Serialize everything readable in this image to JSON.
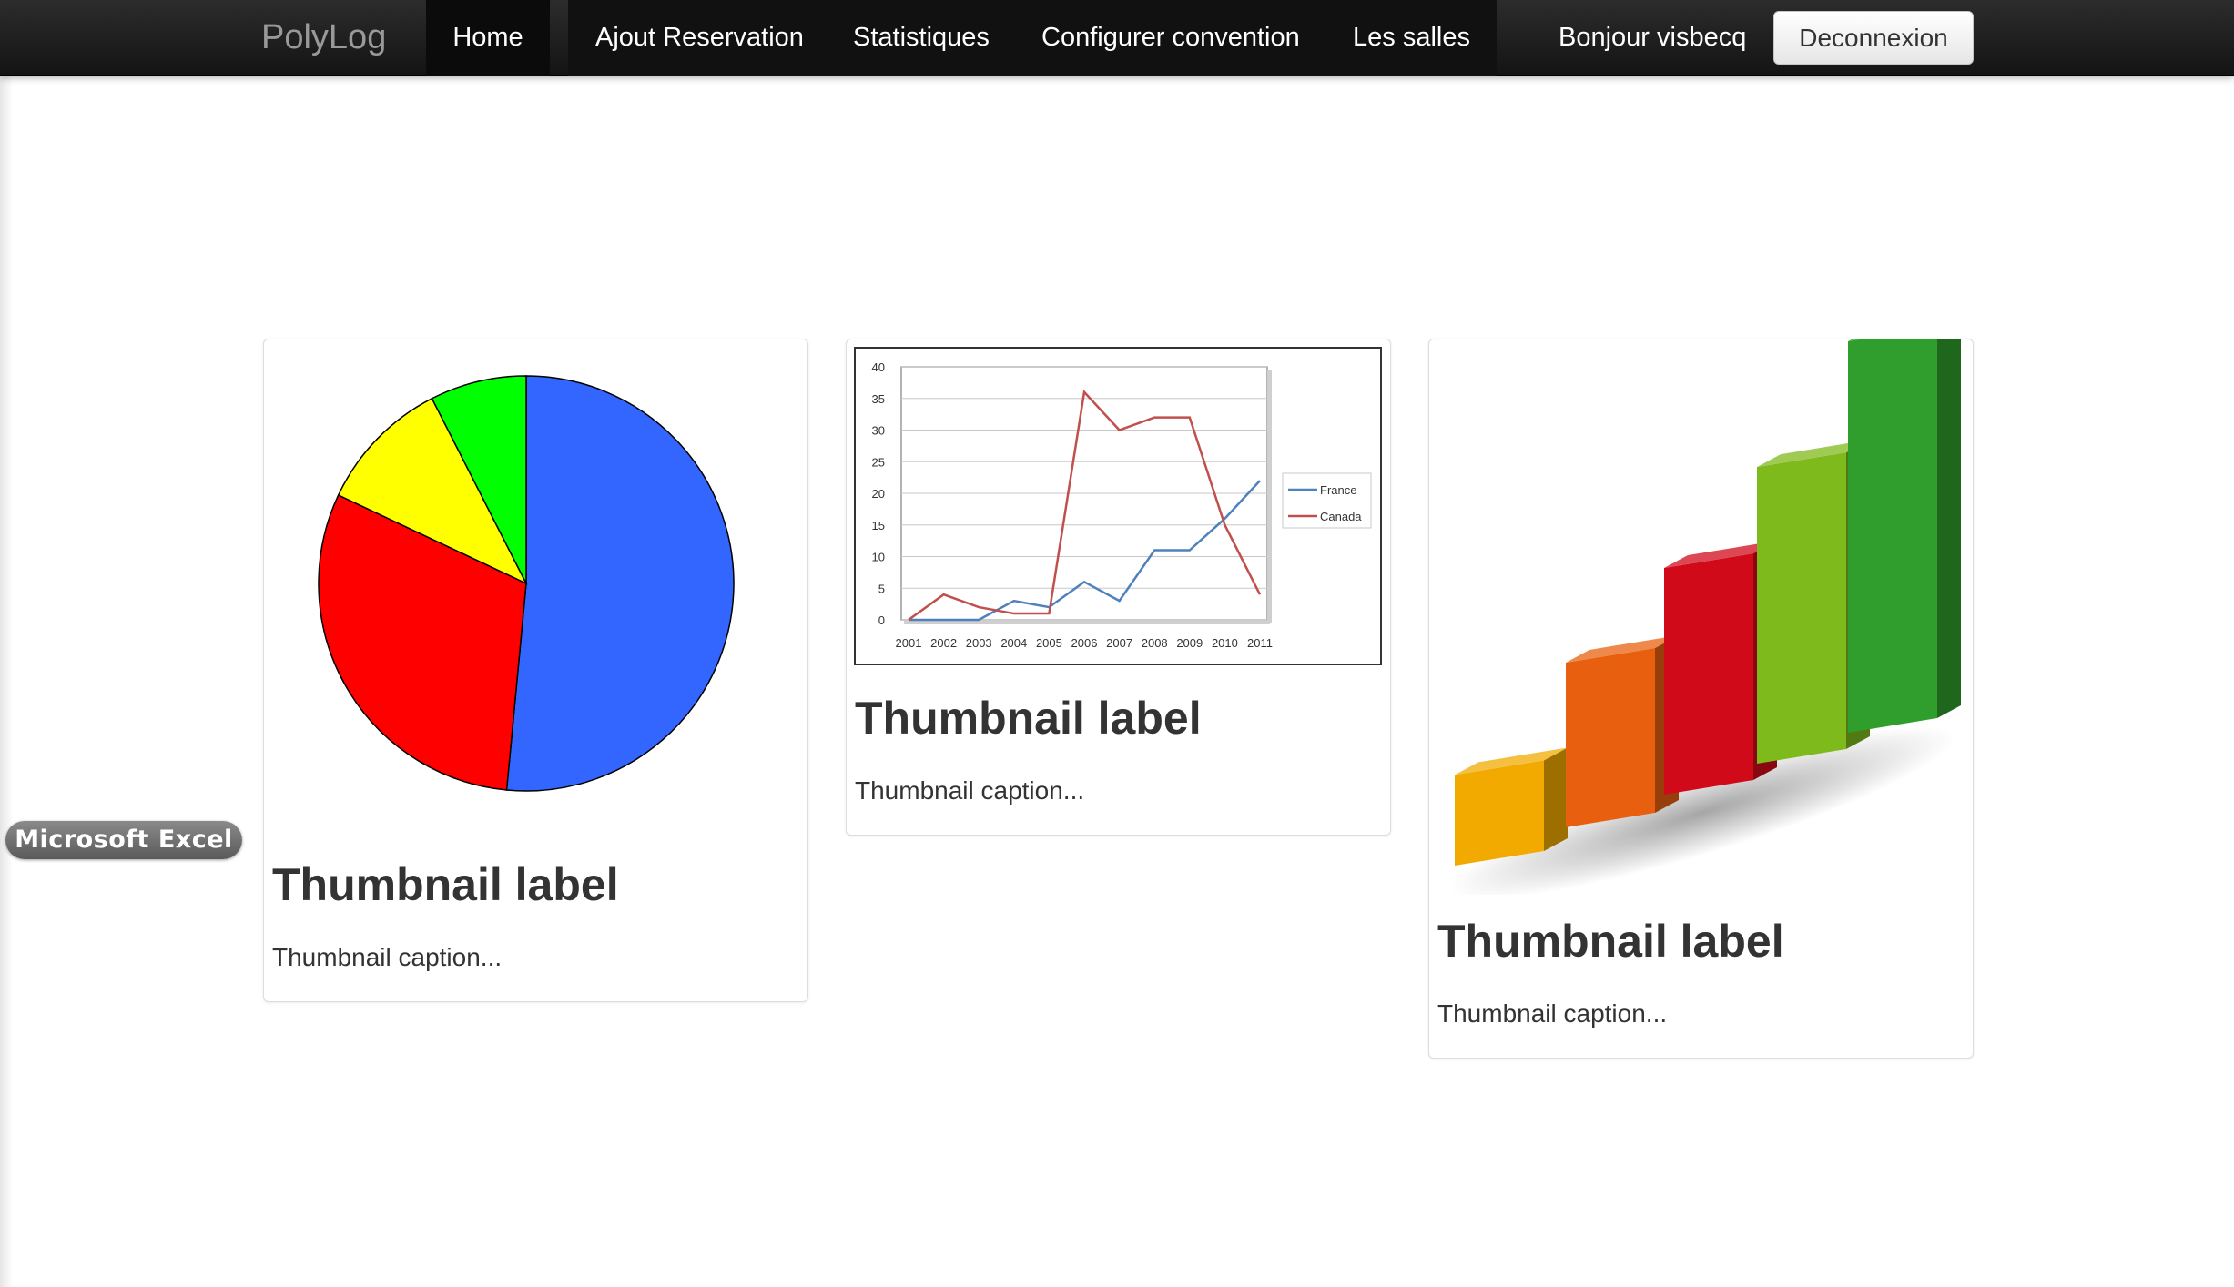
{
  "navbar": {
    "brand": "PolyLog",
    "items": [
      {
        "label": "Home"
      },
      {
        "label": "Ajout Reservation"
      },
      {
        "label": "Statistiques"
      },
      {
        "label": "Configurer convention"
      },
      {
        "label": "Les salles"
      }
    ],
    "greeting": "Bonjour visbecq",
    "logout_label": "Deconnexion"
  },
  "dock_tooltip": "Microsoft Excel",
  "thumbnails": [
    {
      "label": "Thumbnail label",
      "caption": "Thumbnail caption...",
      "image": "pie-chart"
    },
    {
      "label": "Thumbnail label",
      "caption": "Thumbnail caption...",
      "image": "line-chart"
    },
    {
      "label": "Thumbnail label",
      "caption": "Thumbnail caption...",
      "image": "3d-bar-chart"
    }
  ],
  "chart_data": [
    {
      "type": "pie",
      "slices": [
        {
          "value": 51.5,
          "color": "#3366ff"
        },
        {
          "value": 30.5,
          "color": "#ff0000"
        },
        {
          "value": 10.5,
          "color": "#ffff00"
        },
        {
          "value": 7.5,
          "color": "#00ff00"
        }
      ]
    },
    {
      "type": "line",
      "x": [
        "2001",
        "2002",
        "2003",
        "2004",
        "2005",
        "2006",
        "2007",
        "2008",
        "2009",
        "2010",
        "2011"
      ],
      "ylim": [
        0,
        40
      ],
      "yticks": [
        "0",
        "5",
        "10",
        "15",
        "20",
        "25",
        "30",
        "35",
        "40"
      ],
      "series": [
        {
          "name": "France",
          "color": "#4f81bd",
          "values": [
            0,
            0,
            0,
            3,
            2,
            6,
            3,
            11,
            11,
            16,
            22
          ]
        },
        {
          "name": "Canada",
          "color": "#c0504d",
          "values": [
            0,
            4,
            2,
            1,
            1,
            36,
            30,
            32,
            32,
            15,
            4
          ]
        }
      ],
      "legend": "right",
      "grid": true
    },
    {
      "type": "bar",
      "style": "3d",
      "values": [
        22,
        40,
        55,
        72,
        95
      ],
      "colors": [
        "#f2a900",
        "#e8600f",
        "#d10a1a",
        "#7fba1c",
        "#2f9e2c"
      ]
    }
  ]
}
